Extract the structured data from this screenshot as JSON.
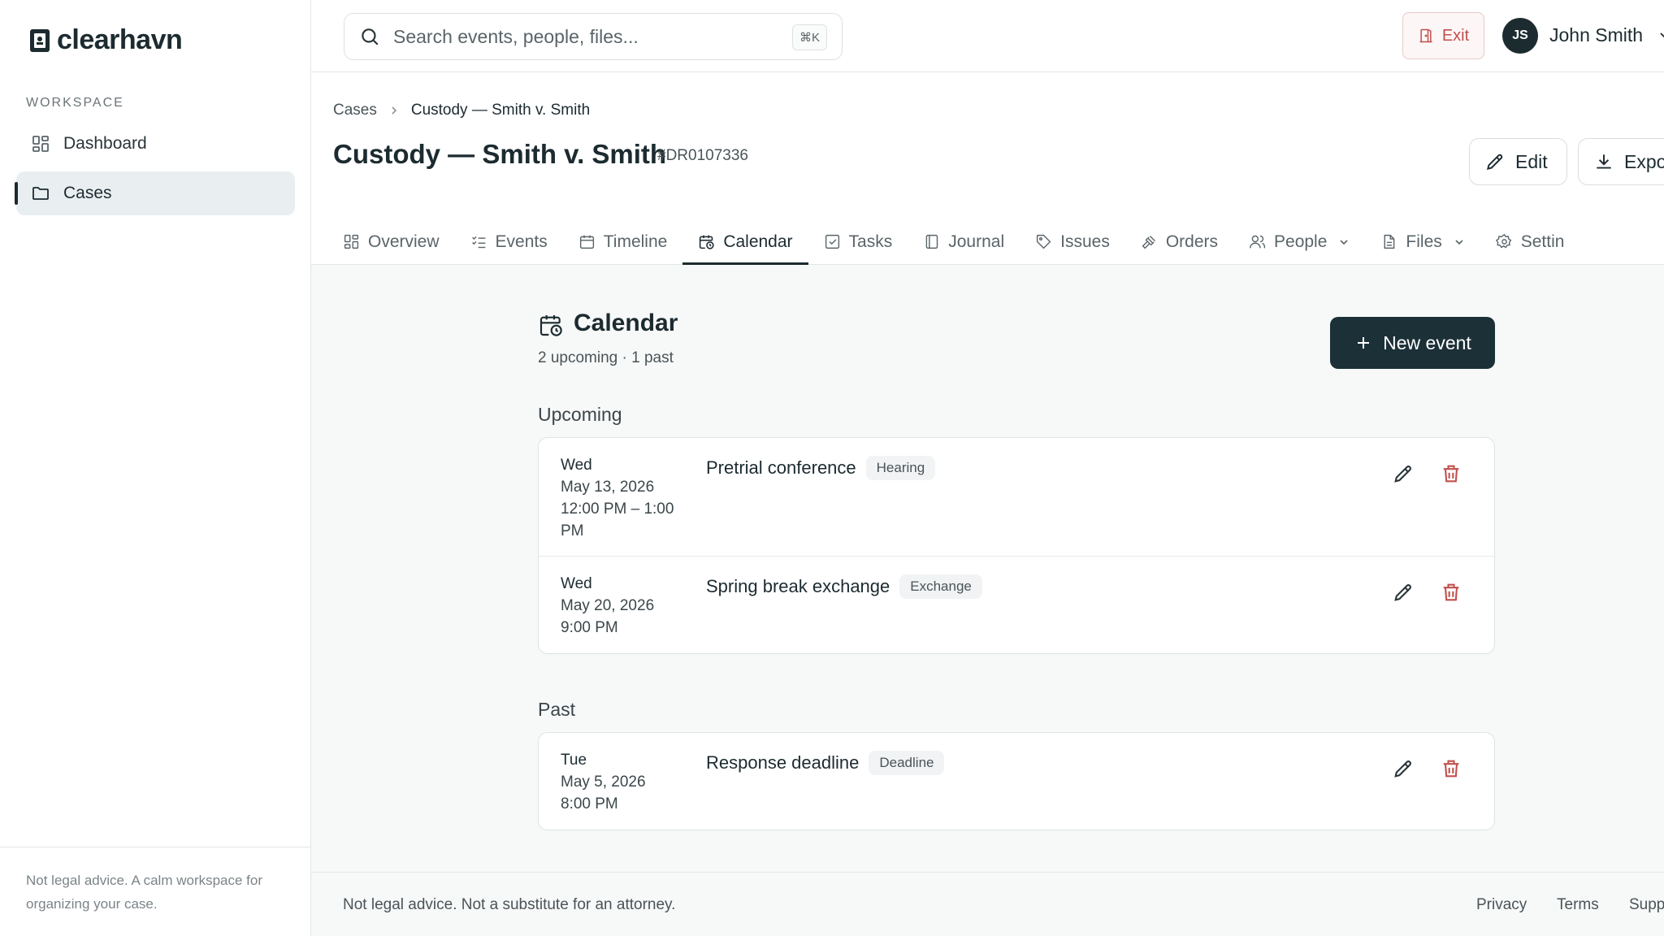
{
  "brand": {
    "name": "clearhavn"
  },
  "sidebar": {
    "section_label": "WORKSPACE",
    "items": [
      {
        "label": "Dashboard",
        "icon": "grid-icon"
      },
      {
        "label": "Cases",
        "icon": "folder-icon",
        "active": true
      }
    ],
    "footer_text": "Not legal advice. A calm workspace for organizing your case."
  },
  "topbar": {
    "search_placeholder": "Search events, people, files...",
    "search_shortcut": "⌘K",
    "exit_label": "Exit",
    "user_initials": "JS",
    "user_name": "John Smith"
  },
  "breadcrumb": {
    "root": "Cases",
    "current": "Custody — Smith v. Smith"
  },
  "case": {
    "title": "Custody — Smith v. Smith",
    "number": "#DR0107336",
    "edit_label": "Edit",
    "export_label": "Expo"
  },
  "tabs": [
    {
      "label": "Overview",
      "icon": "grid-icon"
    },
    {
      "label": "Events",
      "icon": "list-check-icon"
    },
    {
      "label": "Timeline",
      "icon": "calendar-icon"
    },
    {
      "label": "Calendar",
      "icon": "calendar-clock-icon",
      "active": true
    },
    {
      "label": "Tasks",
      "icon": "checkbox-icon"
    },
    {
      "label": "Journal",
      "icon": "notebook-icon"
    },
    {
      "label": "Issues",
      "icon": "tag-icon"
    },
    {
      "label": "Orders",
      "icon": "gavel-icon"
    },
    {
      "label": "People",
      "icon": "users-icon",
      "dropdown": true
    },
    {
      "label": "Files",
      "icon": "file-icon",
      "dropdown": true
    },
    {
      "label": "Settin",
      "icon": "gear-icon"
    }
  ],
  "calendar": {
    "title": "Calendar",
    "summary": "2 upcoming · 1 past",
    "new_event_label": "New event",
    "upcoming_label": "Upcoming",
    "past_label": "Past",
    "upcoming": [
      {
        "dow": "Wed",
        "date": "May 13, 2026",
        "time": "12:00 PM – 1:00 PM",
        "title": "Pretrial conference",
        "badge": "Hearing"
      },
      {
        "dow": "Wed",
        "date": "May 20, 2026",
        "time": "9:00 PM",
        "title": "Spring break exchange",
        "badge": "Exchange"
      }
    ],
    "past": [
      {
        "dow": "Tue",
        "date": "May 5, 2026",
        "time": "8:00 PM",
        "title": "Response deadline",
        "badge": "Deadline"
      }
    ]
  },
  "footer": {
    "disclaimer": "Not legal advice. Not a substitute for an attorney.",
    "links": [
      "Privacy",
      "Terms",
      "Supp"
    ]
  },
  "colors": {
    "primary": "#1c3038",
    "danger": "#c0504d",
    "active_nav_bg": "#e9eff1"
  }
}
